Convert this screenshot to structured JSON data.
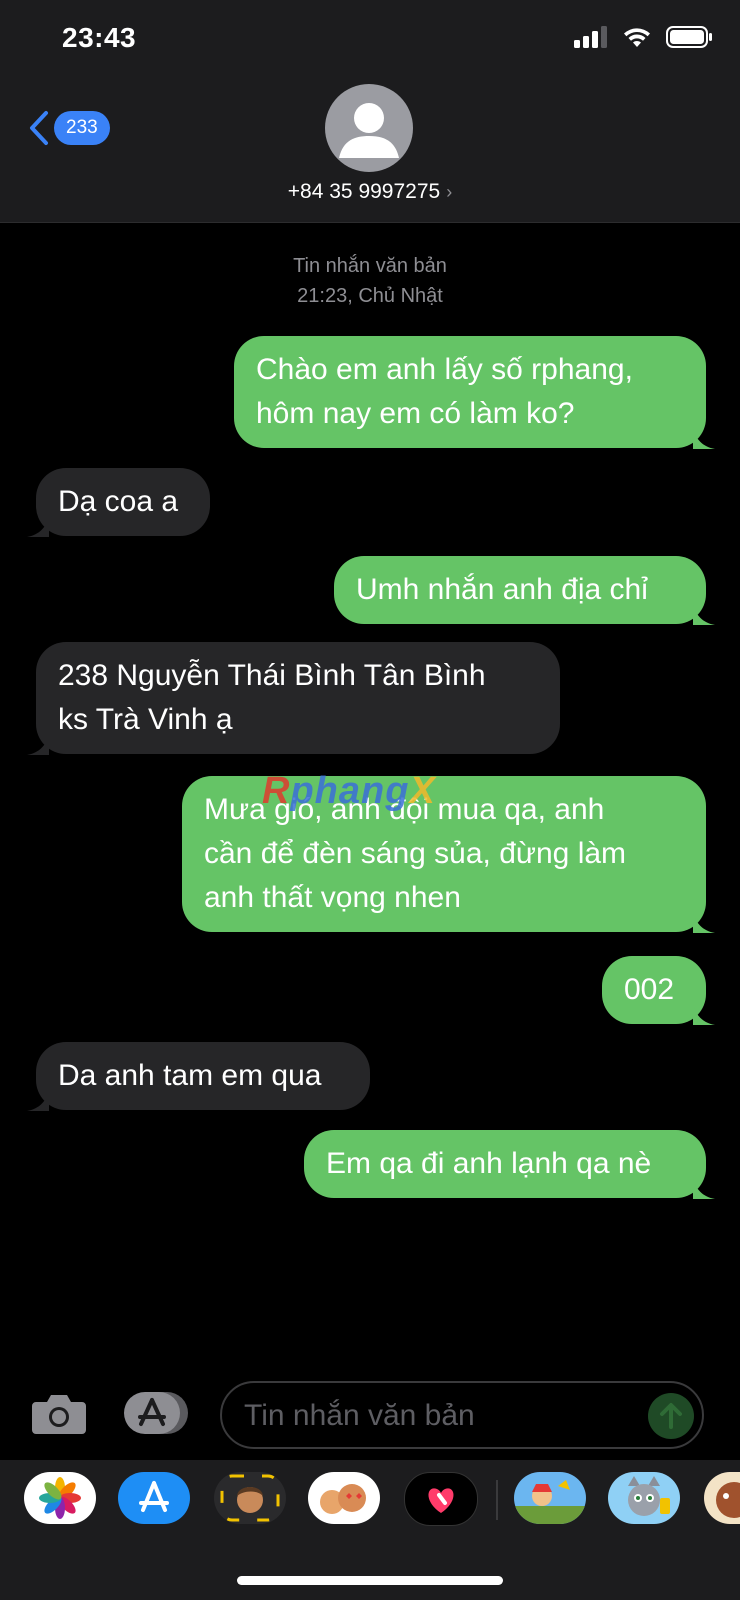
{
  "status_bar": {
    "time": "23:43"
  },
  "header": {
    "back_badge": "233",
    "contact": "+84 35 9997275"
  },
  "thread": {
    "meta_label": "Tin nhắn văn bản",
    "meta_time": "21:23, Chủ Nhật",
    "messages": [
      {
        "side": "out",
        "lines": [
          "Chào em anh lấy số rphang,",
          "hôm nay em có làm ko?"
        ]
      },
      {
        "side": "in",
        "lines": [
          "Dạ coa a"
        ]
      },
      {
        "side": "out",
        "lines": [
          "Umh nhắn anh địa chỉ"
        ]
      },
      {
        "side": "in",
        "lines": [
          "238 Nguyễn Thái Bình Tân Bình",
          "ks Trà Vinh ạ"
        ]
      },
      {
        "side": "out",
        "lines": [
          "Mưa gió, anh đội mua qa, anh",
          "cần để đèn sáng sủa, đừng làm",
          "anh thất vọng nhen"
        ]
      },
      {
        "side": "out",
        "lines": [
          "002"
        ]
      },
      {
        "side": "in",
        "lines": [
          "Da anh tam em qua"
        ]
      },
      {
        "side": "out",
        "lines": [
          "Em qa đi anh lạnh qa nè"
        ]
      }
    ]
  },
  "watermark": {
    "part1": "R",
    "part2": "phang",
    "part3": "X"
  },
  "composer": {
    "placeholder": "Tin nhắn văn bản"
  },
  "app_drawer": [
    "photos-app",
    "app-store-app",
    "memoji-app",
    "memoji-stickers-app",
    "digital-touch-app",
    "game-app",
    "talking-tom-app",
    "game-app-partial"
  ],
  "colors": {
    "outgoing": "#65c466",
    "incoming": "#262628",
    "badge": "#3a82f7"
  }
}
